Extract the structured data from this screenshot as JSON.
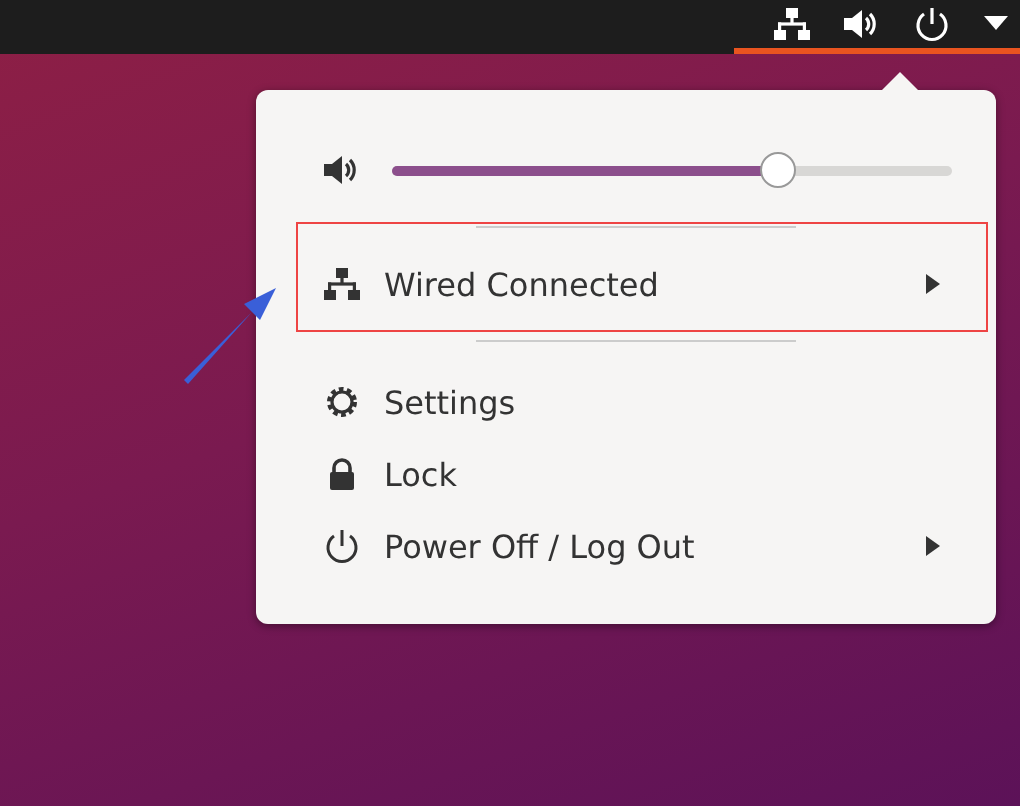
{
  "volume": {
    "level": 0.69
  },
  "network": {
    "label": "Wired Connected",
    "kind": "submenu"
  },
  "items": [
    {
      "label": "Settings",
      "kind": "action"
    },
    {
      "label": "Lock",
      "kind": "action"
    },
    {
      "label": "Power Off / Log Out",
      "kind": "submenu"
    }
  ]
}
